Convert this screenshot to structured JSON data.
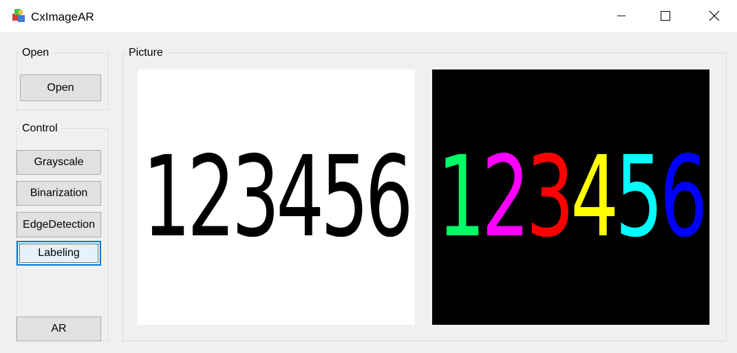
{
  "window": {
    "title": "CxImageAR",
    "controls": {
      "minimize": "minimize",
      "maximize": "maximize",
      "close": "close"
    }
  },
  "groups": {
    "open": {
      "label": "Open",
      "buttons": [
        {
          "label": "Open"
        }
      ]
    },
    "control": {
      "label": "Control",
      "buttons": [
        {
          "label": "Grayscale"
        },
        {
          "label": "Binarization"
        },
        {
          "label": "EdgeDetection"
        },
        {
          "label": "Labeling",
          "focused": true
        },
        {
          "label": "AR"
        }
      ]
    },
    "picture": {
      "label": "Picture"
    }
  },
  "images": {
    "source": {
      "background": "#ffffff",
      "digits": [
        {
          "char": "1",
          "color": "#000000"
        },
        {
          "char": "2",
          "color": "#000000"
        },
        {
          "char": "3",
          "color": "#000000"
        },
        {
          "char": "4",
          "color": "#000000"
        },
        {
          "char": "5",
          "color": "#000000"
        },
        {
          "char": "6",
          "color": "#000000"
        }
      ]
    },
    "labeled": {
      "background": "#000000",
      "digits": [
        {
          "char": "1",
          "color": "#00ff66"
        },
        {
          "char": "2",
          "color": "#ff00ff"
        },
        {
          "char": "3",
          "color": "#ff0000"
        },
        {
          "char": "4",
          "color": "#ffff00"
        },
        {
          "char": "5",
          "color": "#00ffff"
        },
        {
          "char": "6",
          "color": "#0000ff"
        }
      ]
    }
  }
}
